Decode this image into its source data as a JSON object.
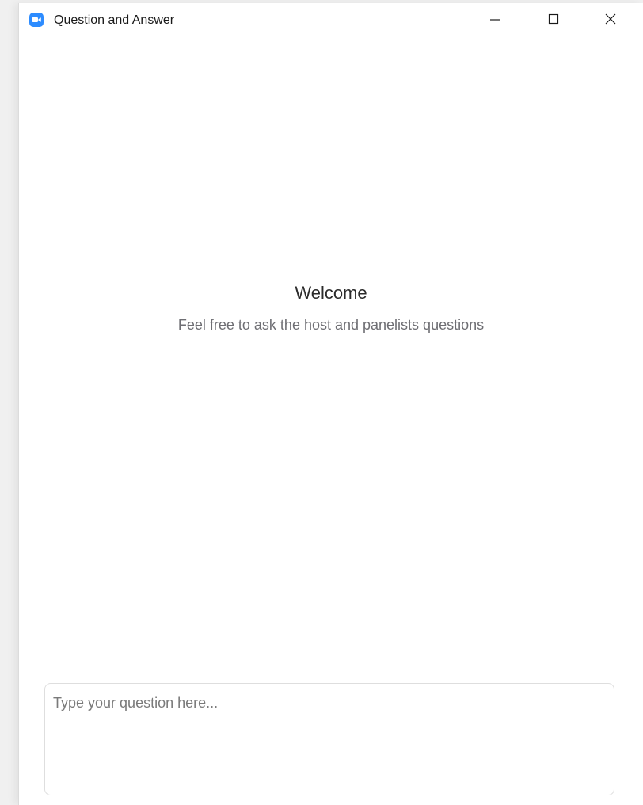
{
  "window": {
    "title": "Question and Answer",
    "controls": {
      "minimize_icon": "minimize-icon",
      "maximize_icon": "maximize-icon",
      "close_icon": "close-icon"
    }
  },
  "main": {
    "welcome_title": "Welcome",
    "welcome_subtitle": "Feel free to ask the host and panelists questions"
  },
  "question_input": {
    "value": "",
    "placeholder": "Type your question here..."
  },
  "colors": {
    "app_icon": "#2d8cff",
    "background": "#ffffff"
  }
}
